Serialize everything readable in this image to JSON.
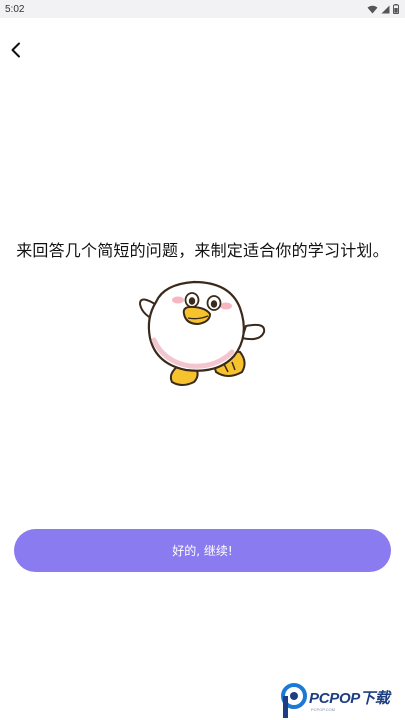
{
  "status_bar": {
    "time": "5:02",
    "icons": [
      "wifi-icon",
      "signal-icon",
      "battery-icon"
    ]
  },
  "header": {
    "back_icon": "chevron-left-icon"
  },
  "main": {
    "intro_text": "来回答几个简短的问题，来制定适合你的学习计划。",
    "mascot": "duck-mascot"
  },
  "actions": {
    "continue_label": "好的, 继续!"
  },
  "watermark": {
    "text": "PCPOP下载",
    "subtext": "PCPOP.COM"
  },
  "colors": {
    "accent": "#8b7bf0",
    "status_bar_bg": "#f2f2f4",
    "watermark": "#1d3e80"
  }
}
